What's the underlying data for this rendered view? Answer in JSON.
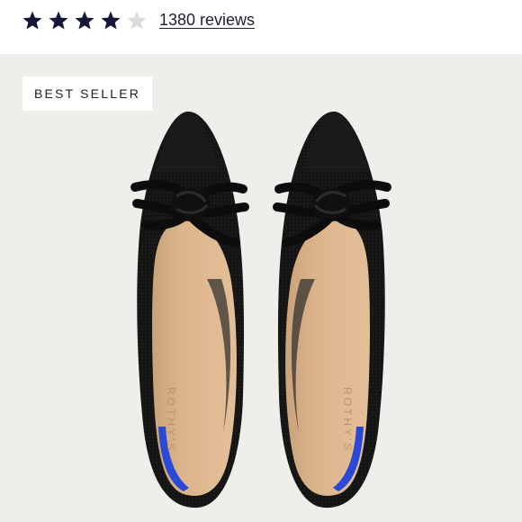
{
  "rating": {
    "value": 4,
    "max": 5,
    "star_color": "#16183a",
    "empty_star_color": "#dcdcdc",
    "reviews_label": "1380 reviews"
  },
  "product_image": {
    "badge_label": "BEST SELLER",
    "insole_brand": "ROTHY'S",
    "background_color": "#efeeea",
    "shoe_color": "#141414",
    "insole_color": "#dcb48c",
    "heel_accent_color": "#2a49d6"
  }
}
